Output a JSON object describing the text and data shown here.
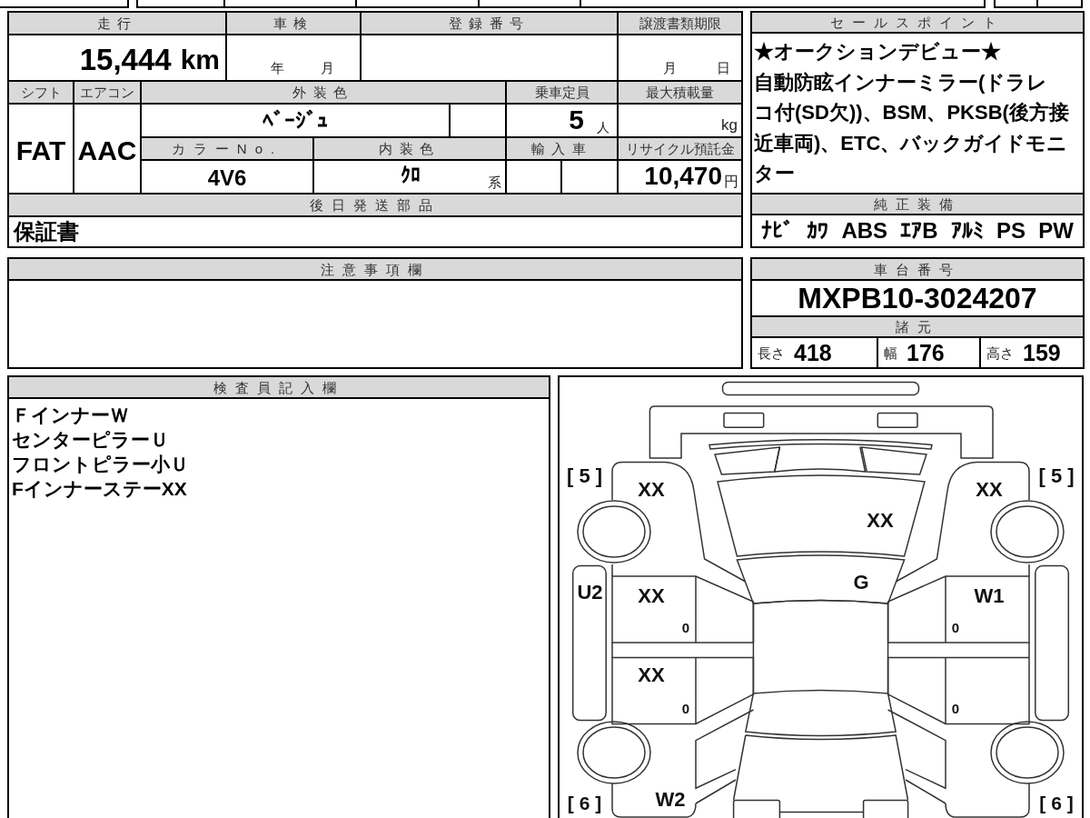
{
  "vehicle_info": {
    "mileage": {
      "label": "走行",
      "value": "15,444",
      "unit": "km"
    },
    "inspection": {
      "label": "車検",
      "year_unit": "年",
      "month_unit": "月"
    },
    "registration_number": {
      "label": "登録番号"
    },
    "transfer_documents_deadline": {
      "label": "譲渡書類期限",
      "month_unit": "月",
      "day_unit": "日"
    },
    "shift": {
      "label": "シフト",
      "value": "FAT"
    },
    "air_conditioner": {
      "label": "エアコン",
      "value": "AAC"
    },
    "exterior_color": {
      "label": "外装色",
      "value": "ﾍﾞｰｼﾞｭ"
    },
    "seating_capacity": {
      "label": "乗車定員",
      "value": "5",
      "unit": "人"
    },
    "max_load": {
      "label": "最大積載量",
      "unit": "kg"
    },
    "color_number": {
      "label": "カラーNo.",
      "value": "4V6"
    },
    "interior_color": {
      "label": "内装色",
      "value": "ｸﾛ",
      "suffix": "系"
    },
    "imported_car": {
      "label": "輸入車"
    },
    "recycling_deposit": {
      "label": "リサイクル預託金",
      "value": "10,470",
      "unit": "円"
    },
    "later_shipped_parts": {
      "label": "後日発送部品",
      "value": "保証書"
    }
  },
  "sales_points": {
    "label": "セールスポイント",
    "lines": [
      "★オークションデビュー★",
      "自動防眩インナーミラー(ドラレ",
      "コ付(SD欠))、BSM、PKSB(後方接",
      "近車両)、ETC、バックガイドモニ",
      "ター"
    ]
  },
  "standard_equipment": {
    "label": "純正装備",
    "items": [
      "ﾅﾋﾞ",
      "ｶﾜ",
      "ABS",
      "ｴｱB",
      "ｱﾙﾐ",
      "PS",
      "PW"
    ]
  },
  "notes": {
    "label": "注意事項欄"
  },
  "chassis_number": {
    "label": "車台番号",
    "value": "MXPB10-3024207"
  },
  "specifications": {
    "label": "諸元",
    "items": [
      {
        "label": "長さ",
        "value": "418"
      },
      {
        "label": "幅",
        "value": "176"
      },
      {
        "label": "高さ",
        "value": "159"
      }
    ]
  },
  "inspector_notes": {
    "label": "検査員記入欄",
    "lines": [
      "ＦインナーＷ",
      "センターピラーＵ",
      "フロントピラー小Ｕ",
      "FインナーステーXX"
    ]
  },
  "damage_diagram": {
    "marks": [
      {
        "kind": "front_left_tire",
        "text": "[ 5 ]"
      },
      {
        "kind": "front_left_fender",
        "text": "XX"
      },
      {
        "kind": "front_right_fender",
        "text": "XX"
      },
      {
        "kind": "front_right_tire",
        "text": "[ 5 ]"
      },
      {
        "kind": "hood",
        "text": "XX"
      },
      {
        "kind": "windshield",
        "text": "G"
      },
      {
        "kind": "left_sill",
        "text": "U2"
      },
      {
        "kind": "left_front_door",
        "text": "XX"
      },
      {
        "kind": "right_front_door",
        "text": "W1"
      },
      {
        "kind": "left_front_door_mark",
        "text": "0"
      },
      {
        "kind": "right_front_door_mark",
        "text": "0"
      },
      {
        "kind": "left_rear_door",
        "text": "XX"
      },
      {
        "kind": "left_rear_door_mark",
        "text": "0"
      },
      {
        "kind": "right_rear_door_mark",
        "text": "0"
      },
      {
        "kind": "rear_left_tire",
        "text": "[ 6 ]"
      },
      {
        "kind": "rear_left_quarter",
        "text": "W2"
      },
      {
        "kind": "rear_right_tire",
        "text": "[ 6 ]"
      }
    ]
  }
}
